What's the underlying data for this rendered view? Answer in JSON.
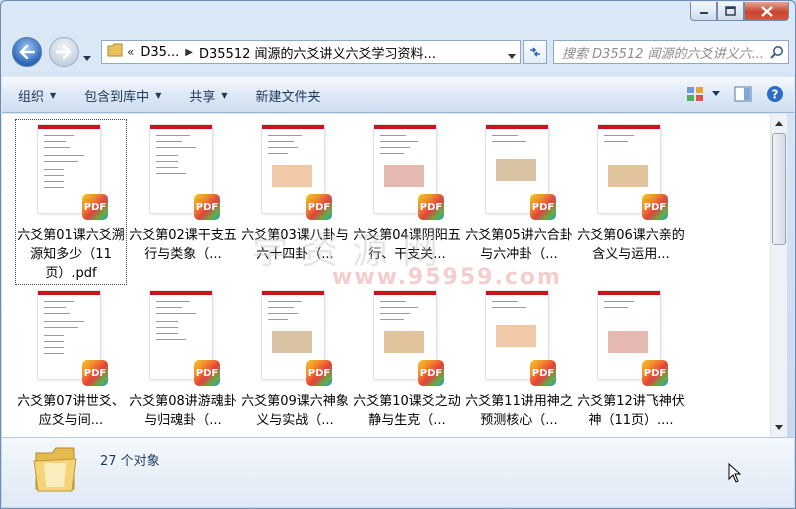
{
  "window": {
    "caption_buttons": [
      "minimize",
      "maximize",
      "close"
    ]
  },
  "address": {
    "overflow": "«",
    "segments": [
      "D35...",
      "D35512 闻源的六爻讲义六爻学习资料..."
    ],
    "separator": "▶"
  },
  "search": {
    "placeholder": "搜索 D35512 闻源的六爻讲义六..."
  },
  "toolbar": {
    "organize": "组织",
    "include_library": "包含到库中",
    "share": "共享",
    "new_folder": "新建文件夹"
  },
  "files": [
    {
      "label": "六爻第01课六爻溯源知多少（11页）.pdf",
      "selected": true
    },
    {
      "label": "六爻第02课干支五行与类象（...",
      "selected": false
    },
    {
      "label": "六爻第03课八卦与六十四卦（...",
      "selected": false
    },
    {
      "label": "六爻第04课阴阳五行、干支关...",
      "selected": false
    },
    {
      "label": "六爻第05讲六合卦与六冲卦（...",
      "selected": false
    },
    {
      "label": "六爻第06课六亲的含义与运用...",
      "selected": false
    },
    {
      "label": "六爻第07讲世爻、应爻与间...",
      "selected": false
    },
    {
      "label": "六爻第08讲游魂卦与归魂卦（...",
      "selected": false
    },
    {
      "label": "六爻第09课六神象义与实战（...",
      "selected": false
    },
    {
      "label": "六爻第10课爻之动静与生克（...",
      "selected": false
    },
    {
      "label": "六爻第11讲用神之预测核心（...",
      "selected": false
    },
    {
      "label": "六爻第12讲飞神伏神（11页）....",
      "selected": false
    }
  ],
  "file_badge": "PDF",
  "thumbnail_header": "PDF",
  "watermark": {
    "main": "学资源网",
    "url": "www.95959.com"
  },
  "status": {
    "count": "27 个对象"
  },
  "colors": {
    "pdf_red": "#c8141c",
    "selection_border": "#444444",
    "toolbar_text": "#1e395b"
  }
}
